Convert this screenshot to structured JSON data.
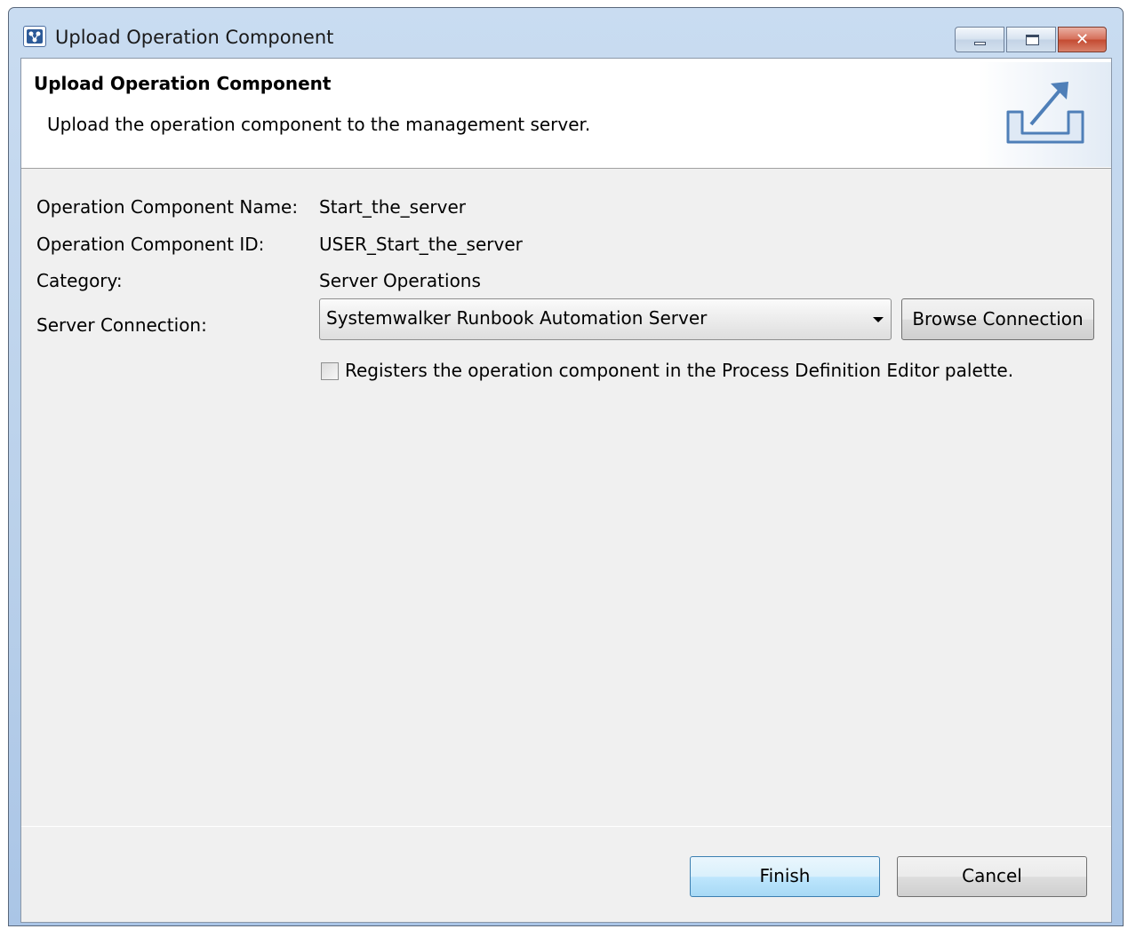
{
  "window": {
    "title": "Upload Operation Component",
    "controls": {
      "minimize": "minimize",
      "maximize": "maximize",
      "close": "close"
    }
  },
  "header": {
    "title": "Upload Operation Component",
    "description": "Upload the operation component to the management server.",
    "icon": "upload-icon"
  },
  "form": {
    "name_label": "Operation Component Name:",
    "name_value": "Start_the_server",
    "id_label": "Operation Component ID:",
    "id_value": "USER_Start_the_server",
    "category_label": "Category:",
    "category_value": "Server Operations",
    "server_label": "Server Connection:",
    "server_selected": "Systemwalker Runbook Automation Server",
    "browse_label": "Browse Connection",
    "register_label": "Registers the operation component in the Process Definition Editor palette.",
    "register_checked": false
  },
  "footer": {
    "finish_label": "Finish",
    "cancel_label": "Cancel"
  },
  "colors": {
    "titlebar": "#b9d0ea",
    "dialog_bg": "#f0f0f0",
    "header_bg": "#ffffff",
    "default_button_border": "#3c7fb1"
  }
}
